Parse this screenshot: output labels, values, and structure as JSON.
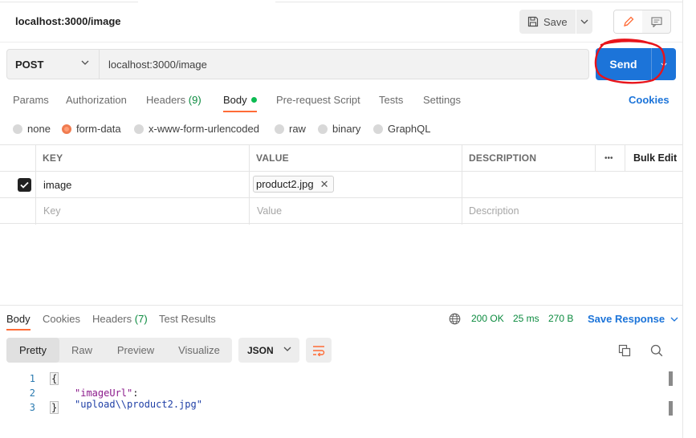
{
  "request": {
    "title": "localhost:3000/image",
    "save_label": "Save",
    "method": "POST",
    "url": "localhost:3000/image",
    "send_label": "Send"
  },
  "request_tabs": [
    {
      "label": "Params"
    },
    {
      "label": "Authorization"
    },
    {
      "label": "Headers",
      "count": "(9)"
    },
    {
      "label": "Body",
      "active": true
    },
    {
      "label": "Pre-request Script"
    },
    {
      "label": "Tests"
    },
    {
      "label": "Settings"
    }
  ],
  "cookies_label": "Cookies",
  "body_types": [
    {
      "label": "none"
    },
    {
      "label": "form-data",
      "selected": true
    },
    {
      "label": "x-www-form-urlencoded"
    },
    {
      "label": "raw"
    },
    {
      "label": "binary"
    },
    {
      "label": "GraphQL"
    }
  ],
  "form_table": {
    "headers": {
      "key": "KEY",
      "value": "VALUE",
      "description": "DESCRIPTION",
      "more": "•••",
      "bulk_edit": "Bulk Edit"
    },
    "rows": [
      {
        "checked": true,
        "key": "image",
        "value": "product2.jpg",
        "description": ""
      }
    ],
    "placeholders": {
      "key": "Key",
      "value": "Value",
      "description": "Description"
    }
  },
  "response_tabs": [
    {
      "label": "Body",
      "active": true
    },
    {
      "label": "Cookies"
    },
    {
      "label": "Headers",
      "count": "(7)"
    },
    {
      "label": "Test Results"
    }
  ],
  "response_status": {
    "status": "200 OK",
    "time": "25 ms",
    "size": "270 B",
    "save_response": "Save Response"
  },
  "view_modes": [
    "Pretty",
    "Raw",
    "Preview",
    "Visualize"
  ],
  "format": "JSON",
  "response_body": {
    "lines": [
      {
        "n": "1",
        "text": "{"
      },
      {
        "n": "2",
        "key": "\"imageUrl\"",
        "colon": ": ",
        "value": "\"upload\\\\product2.jpg\""
      },
      {
        "n": "3",
        "text": "}"
      }
    ]
  },
  "colors": {
    "accent_orange": "#ff6c37",
    "send_blue": "#1c74d9",
    "status_green": "#0a8a3e",
    "annotation_red": "#e8141b"
  },
  "icons": [
    "save-icon",
    "chevron-down-icon",
    "pencil-icon",
    "comment-icon",
    "close-icon",
    "globe-icon",
    "wrap-lines-icon",
    "copy-icon",
    "search-icon"
  ]
}
